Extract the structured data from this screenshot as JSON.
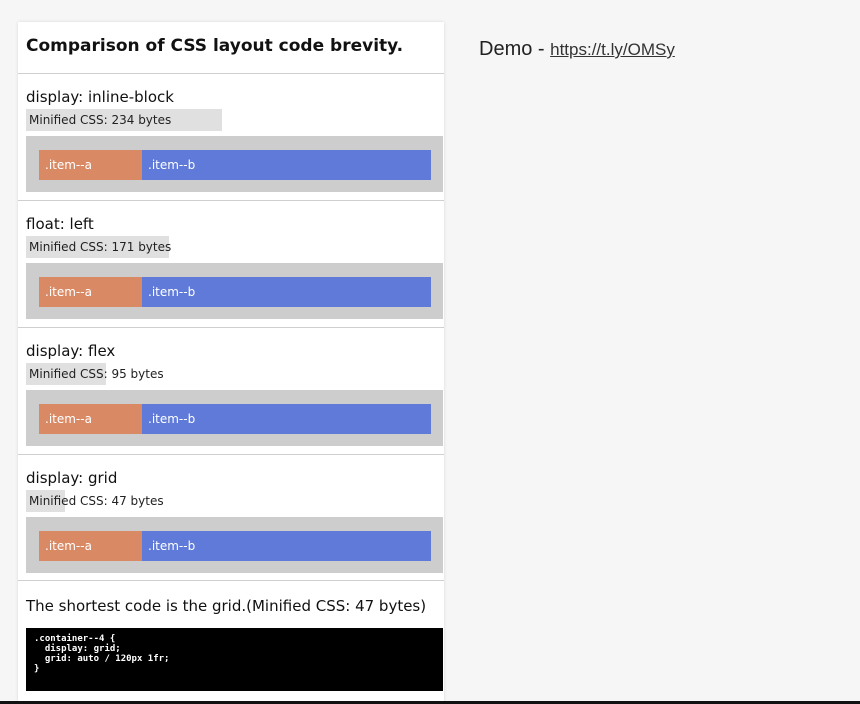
{
  "card": {
    "title": "Comparison of CSS layout code brevity.",
    "sections": [
      {
        "heading": "display: inline-block",
        "size_label": "Minified CSS: 234 bytes",
        "size_fraction": 1.0,
        "item_a": ".item--a",
        "item_b": ".item--b"
      },
      {
        "heading": "float: left",
        "size_label": "Minified CSS: 171 bytes",
        "size_fraction": 0.73,
        "item_a": ".item--a",
        "item_b": ".item--b"
      },
      {
        "heading": "display: flex",
        "size_label": "Minified CSS: 95 bytes",
        "size_fraction": 0.41,
        "item_a": ".item--a",
        "item_b": ".item--b"
      },
      {
        "heading": "display: grid",
        "size_label": "Minified CSS: 47 bytes",
        "size_fraction": 0.2,
        "item_a": ".item--a",
        "item_b": ".item--b"
      }
    ],
    "conclusion": "The shortest code is the grid.(Minified CSS: 47 bytes)",
    "code": ".container--4 {\n  display: grid;\n  grid: auto / 120px 1fr;\n}"
  },
  "demo": {
    "label": "Demo - ",
    "link": "https://t.ly/OMSy"
  },
  "colors": {
    "item_a": "#d98a64",
    "item_b": "#5f7ad9",
    "demo_box": "#cdcdcd",
    "size_bar": "#e0e0e0"
  }
}
